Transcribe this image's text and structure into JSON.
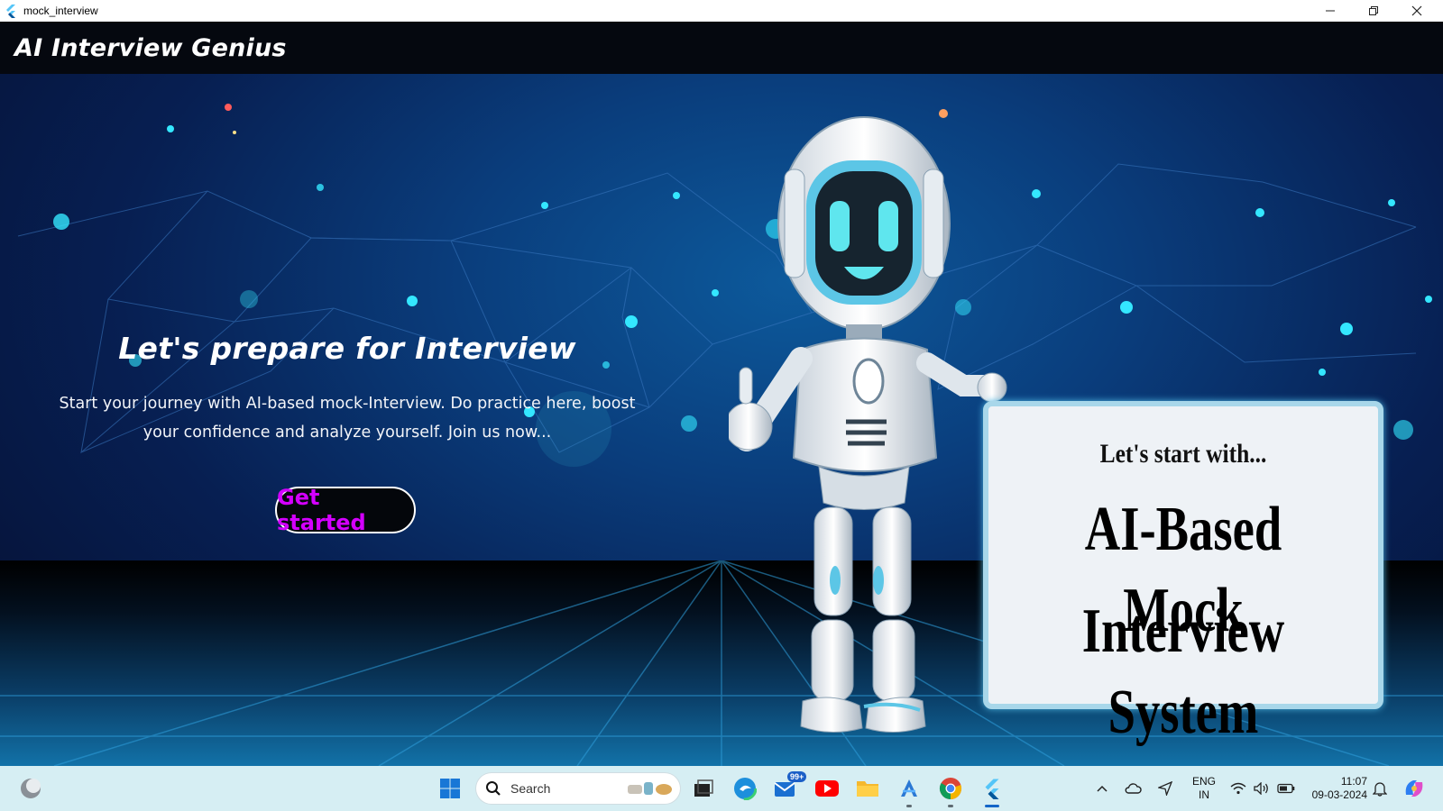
{
  "window": {
    "title": "mock_interview"
  },
  "appbar": {
    "title": "AI Interview Genius"
  },
  "hero": {
    "headline": "Let's prepare for Interview",
    "subtext": "Start your journey with AI-based mock-Interview. Do practice here, boost your confidence and analyze yourself. Join us now...",
    "cta_label": "Get started",
    "sign": {
      "line1": "Let's start with...",
      "line2": "AI-Based Mock",
      "line3": "Interview System"
    }
  },
  "taskbar": {
    "search_label": "Search",
    "mail_badge": "99+",
    "language_line1": "ENG",
    "language_line2": "IN",
    "time": "11:07",
    "date": "09-03-2024",
    "pinned": [
      "start-icon",
      "search",
      "task-view-icon",
      "edge-icon",
      "mail-icon",
      "youtube-icon",
      "file-explorer-icon",
      "app-installer-icon",
      "chrome-icon",
      "flutter-app-icon"
    ]
  },
  "colors": {
    "cta_text": "#d400ff",
    "appbar_bg": "#05080f",
    "taskbar_bg": "#d6eef3"
  }
}
